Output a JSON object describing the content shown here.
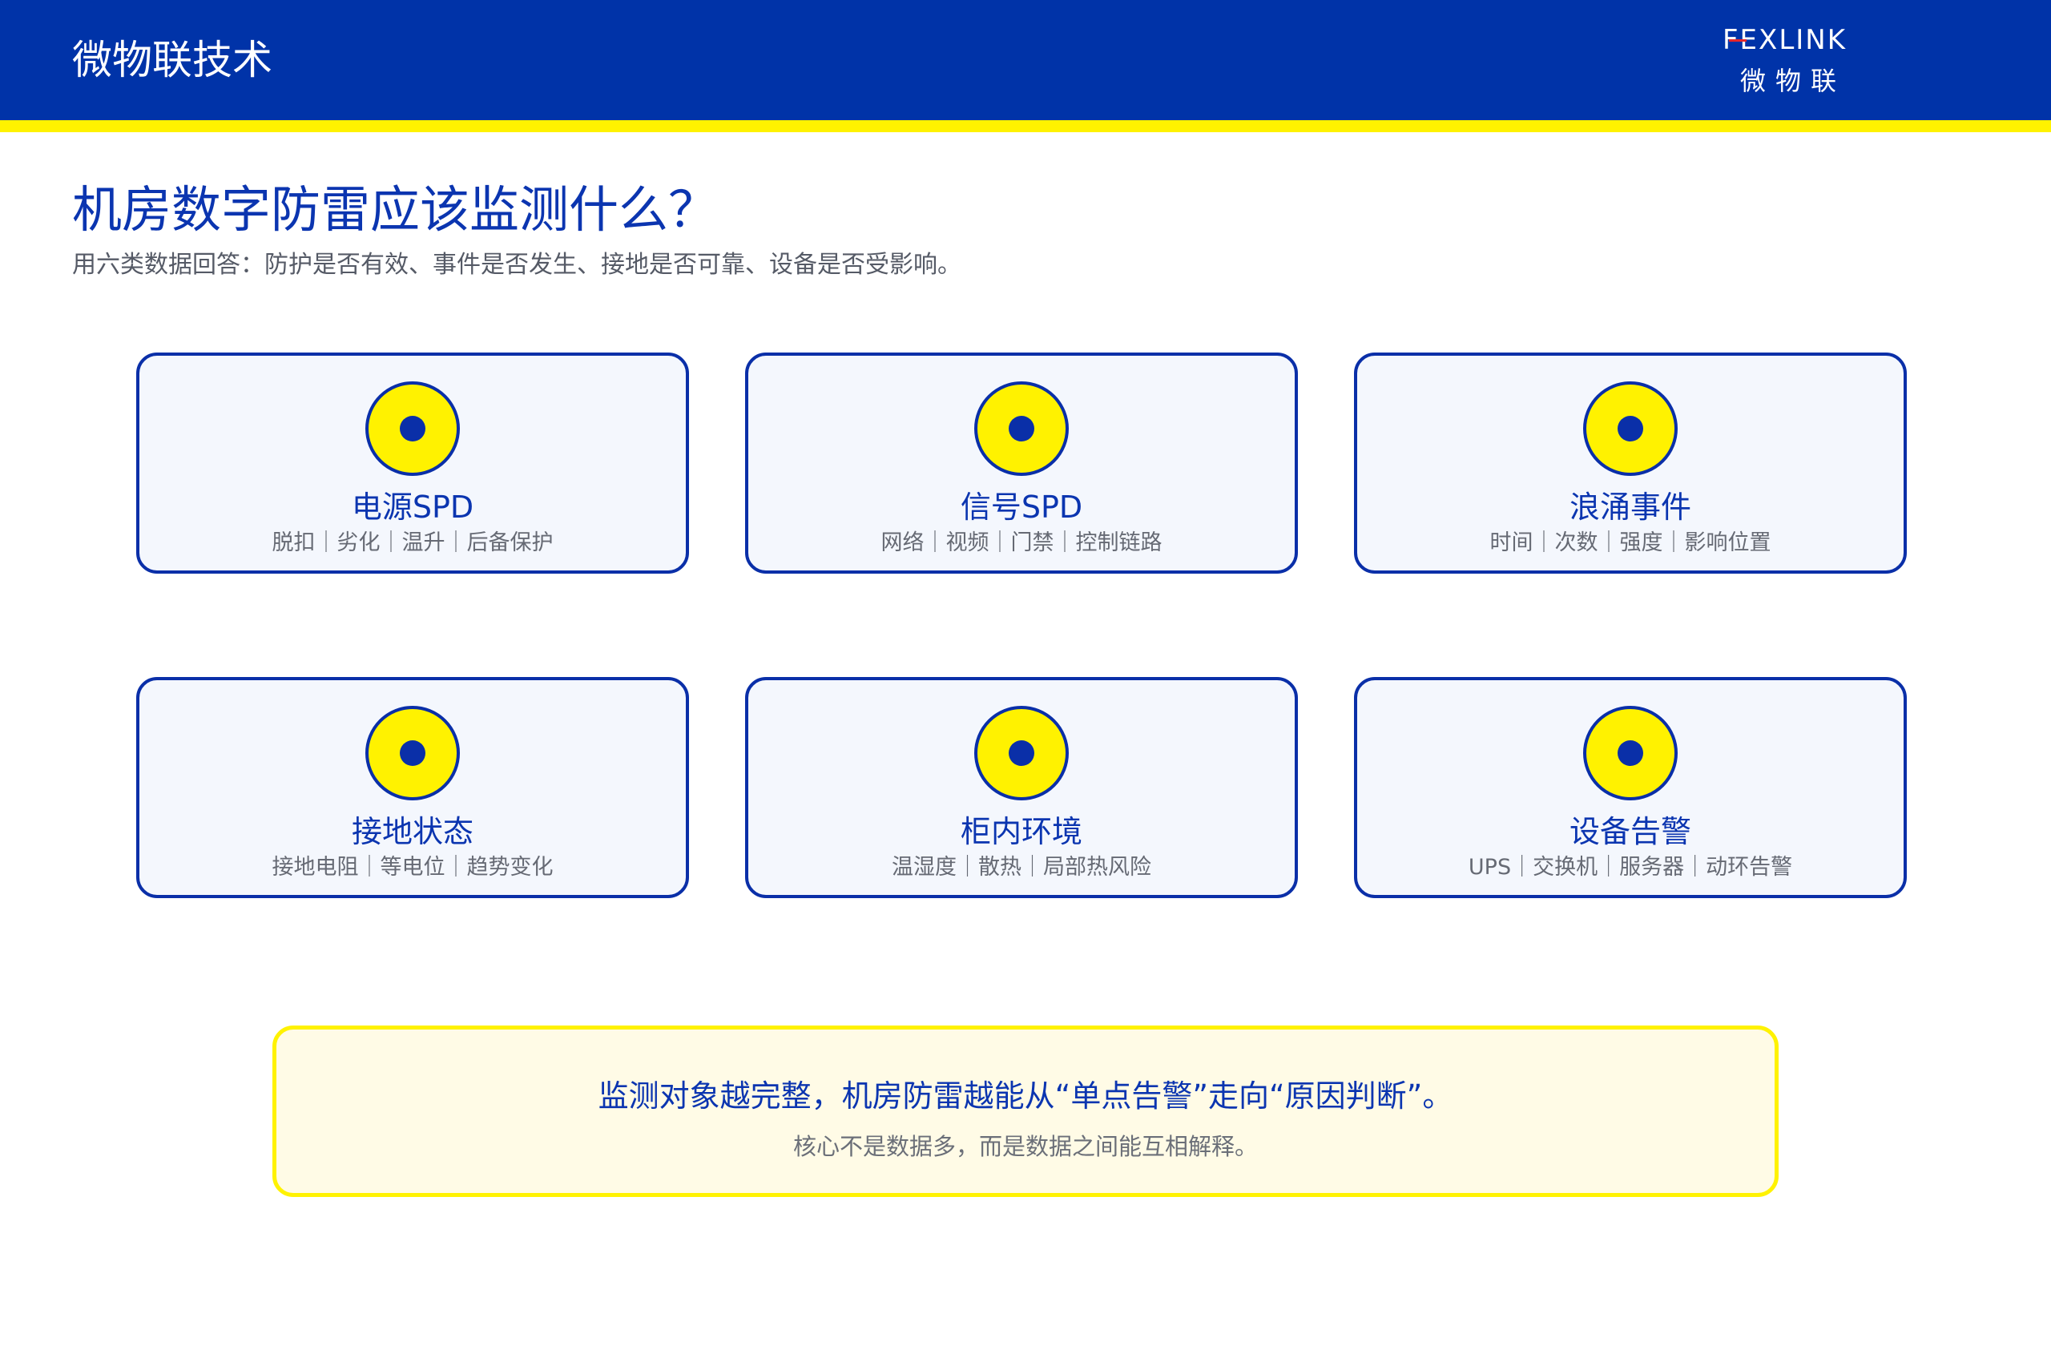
{
  "header": {
    "title": "微物联技术",
    "logo_text": "FEXLINK",
    "logo_subtitle": "微物联"
  },
  "page": {
    "title": "机房数字防雷应该监测什么？",
    "subtitle": "用六类数据回答：防护是否有效、事件是否发生、接地是否可靠、设备是否受影响。"
  },
  "cards": [
    {
      "title": "电源SPD",
      "desc": "脱扣｜劣化｜温升｜后备保护"
    },
    {
      "title": "信号SPD",
      "desc": "网络｜视频｜门禁｜控制链路"
    },
    {
      "title": "浪涌事件",
      "desc": "时间｜次数｜强度｜影响位置"
    },
    {
      "title": "接地状态",
      "desc": "接地电阻｜等电位｜趋势变化"
    },
    {
      "title": "柜内环境",
      "desc": "温湿度｜散热｜局部热风险"
    },
    {
      "title": "设备告警",
      "desc": "UPS｜交换机｜服务器｜动环告警"
    }
  ],
  "callout": {
    "main": "监测对象越完整，机房防雷越能从“单点告警”走向“原因判断”。",
    "sub": "核心不是数据多，而是数据之间能互相解释。"
  },
  "colors": {
    "brand_blue": "#0033a8",
    "accent_yellow": "#fff200",
    "logo_red": "#e8262a"
  },
  "icons": {
    "card_icon": "yellow-circle-dot-icon"
  }
}
